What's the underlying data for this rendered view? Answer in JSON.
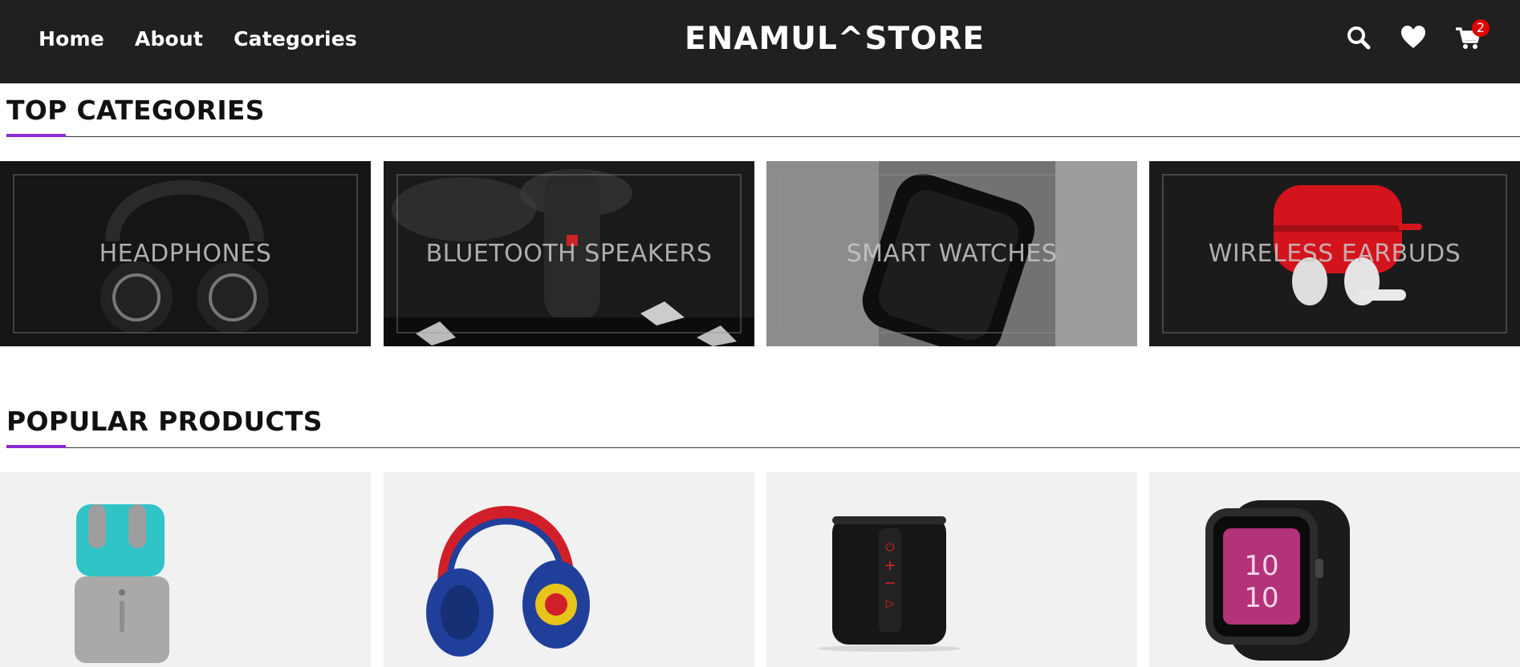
{
  "header": {
    "nav": [
      "Home",
      "About",
      "Categories"
    ],
    "brand": "ENAMUL^STORE",
    "cart_count": "2",
    "icons": [
      "search-icon",
      "heart-icon",
      "cart-icon"
    ]
  },
  "sections": {
    "top_categories": "TOP CATEGORIES",
    "popular_products": "POPULAR PRODUCTS"
  },
  "categories": [
    {
      "label": "HEADPHONES"
    },
    {
      "label": "BLUETOOTH SPEAKERS"
    },
    {
      "label": "SMART WATCHES"
    },
    {
      "label": "WIRELESS EARBUDS"
    }
  ],
  "colors": {
    "header_bg": "#202020",
    "accent": "#8a2bd1",
    "badge": "#e10000",
    "card_bg": "#f1f1f1"
  }
}
